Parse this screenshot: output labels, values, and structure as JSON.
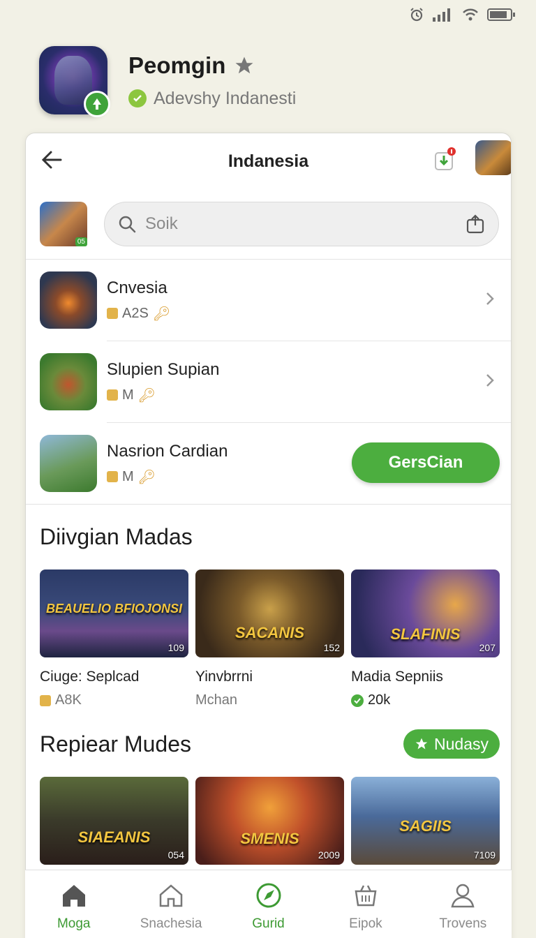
{
  "header": {
    "app_name": "Peomgin",
    "developer": "Adevshy Indanesti"
  },
  "topbar": {
    "title": "Indanesia"
  },
  "search": {
    "placeholder": "Soik",
    "thumb_badge": "05"
  },
  "list": [
    {
      "name": "Cnvesia",
      "meta": "A2S",
      "action": "chevron"
    },
    {
      "name": "Slupien Supian",
      "meta": "M",
      "action": "chevron"
    },
    {
      "name": "Nasrion Cardian",
      "meta": "M",
      "action_label": "GersCian"
    }
  ],
  "section1": {
    "title": "Diivgian Madas",
    "tiles": [
      {
        "caption": "BEAUELIO BFIOJONSI",
        "count": "109",
        "name": "Ciuge: Seplcad",
        "meta": "A8K"
      },
      {
        "caption": "SACANIS",
        "count": "152",
        "name": "Yinvbrrni",
        "meta": "Mchan"
      },
      {
        "caption": "SLAFINIS",
        "count": "207",
        "name": "Madia Sepniis",
        "meta": "20k"
      }
    ]
  },
  "section2": {
    "title": "Repiear Mudes",
    "button_label": "Nudasy",
    "tiles": [
      {
        "caption": "SIAEANIS",
        "count": "054"
      },
      {
        "caption": "SMENIS",
        "count": "2009"
      },
      {
        "caption": "SAGIIS",
        "count": "7109"
      }
    ]
  },
  "nav": [
    {
      "label": "Moga",
      "icon": "home-icon"
    },
    {
      "label": "Snachesia",
      "icon": "house-outline-icon"
    },
    {
      "label": "Gurid",
      "icon": "compass-icon"
    },
    {
      "label": "Eipok",
      "icon": "basket-icon"
    },
    {
      "label": "Trovens",
      "icon": "profile-icon"
    }
  ],
  "colors": {
    "accent": "#4cae3f",
    "background": "#f2f1e6"
  }
}
